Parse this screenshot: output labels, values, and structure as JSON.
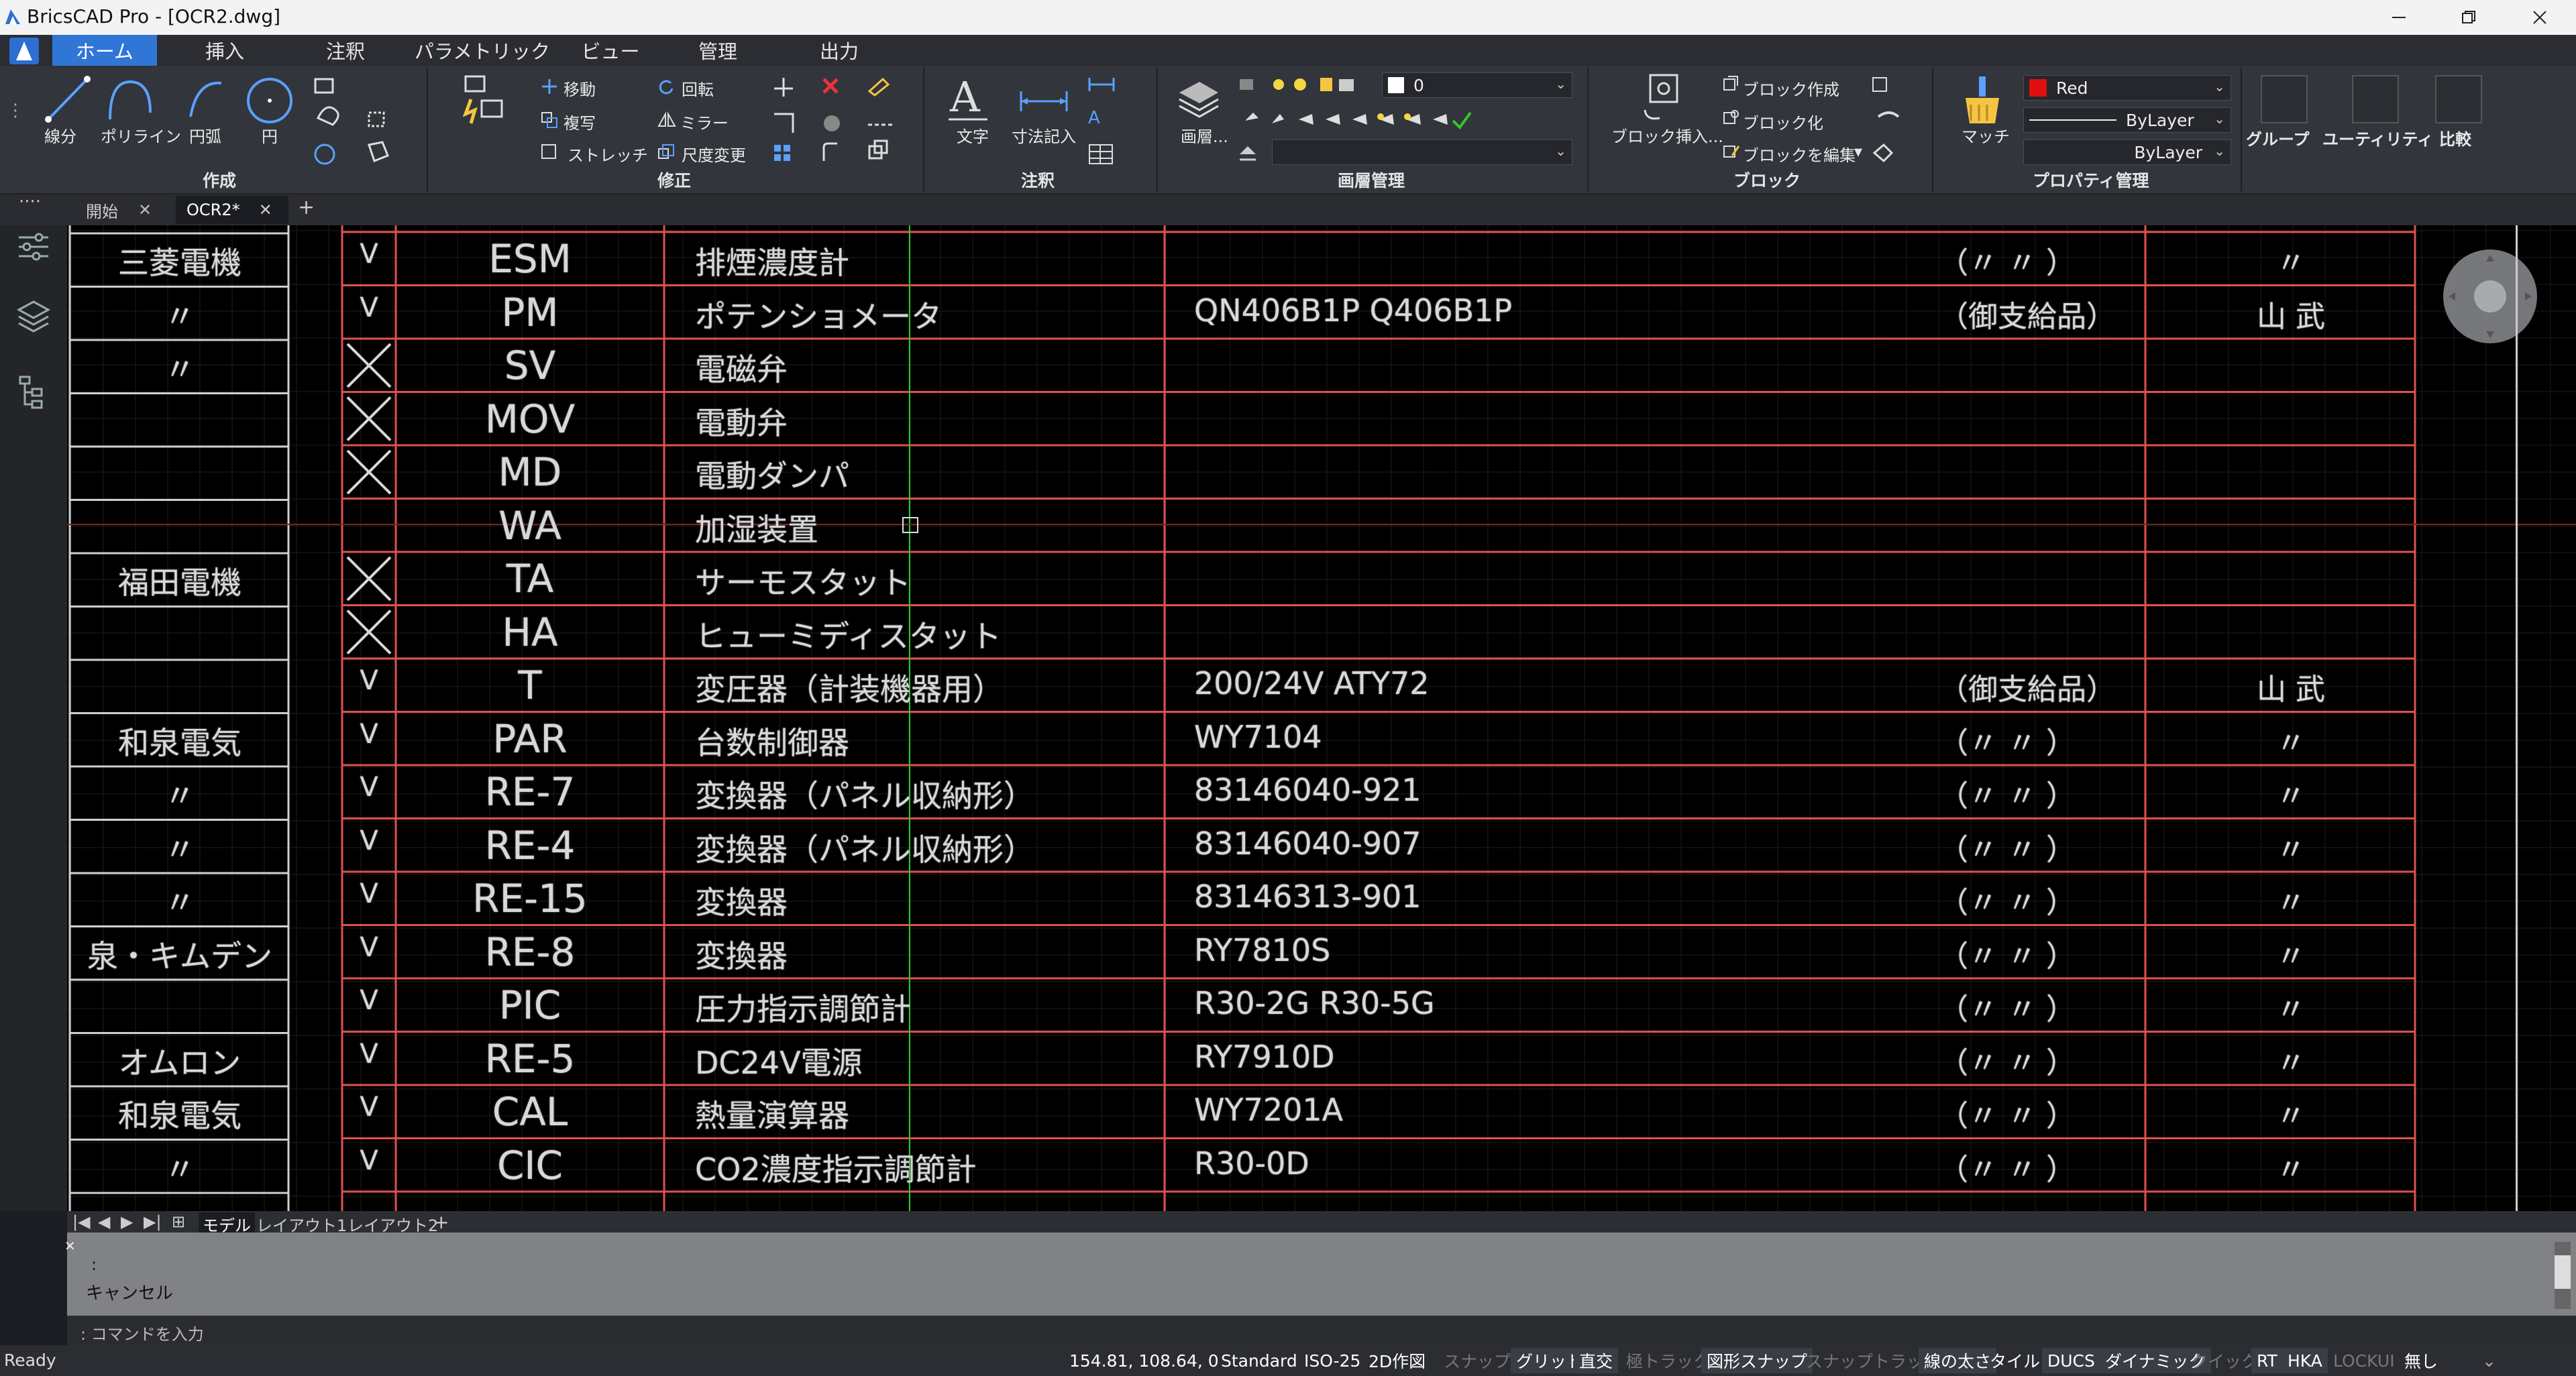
{
  "window": {
    "title": "BricsCAD Pro - [OCR2.dwg]"
  },
  "ribbon_tabs": [
    "ホーム",
    "挿入",
    "注釈",
    "パラメトリック",
    "ビュー",
    "管理",
    "出力"
  ],
  "panels": {
    "create": {
      "label": "作成",
      "tools": [
        "線分",
        "ポリライン",
        "円弧",
        "円"
      ]
    },
    "modify": {
      "label": "修正",
      "tools": [
        "移動",
        "複写",
        "ストレッチ",
        "回転",
        "ミラー",
        "尺度変更"
      ]
    },
    "annotation": {
      "label": "注釈",
      "tools": [
        "文字",
        "寸法記入"
      ]
    },
    "layers": {
      "label": "画層管理",
      "tool": "画層...",
      "current_layer": "0"
    },
    "block": {
      "label": "ブロック",
      "tools": [
        "ブロック挿入...",
        "ブロック作成",
        "ブロック化",
        "ブロックを編集"
      ]
    },
    "properties": {
      "label": "プロパティ管理",
      "match": "マッチ",
      "color": "Red",
      "linetype": "ByLayer",
      "lineweight": "ByLayer"
    },
    "extra": [
      "グループ",
      "ユーティリティ",
      "比較"
    ]
  },
  "doc_tabs": [
    "開始",
    "OCR2*"
  ],
  "layout_tabs": [
    "モデル",
    "レイアウト1",
    "レイアウト2"
  ],
  "table_rows": [
    {
      "maker": "三菱電機",
      "check": "V",
      "tag": "ESM",
      "name": "排煙濃度計",
      "model": "",
      "note": "（〃 〃 ）",
      "dept": "〃"
    },
    {
      "maker": "〃",
      "check": "V",
      "tag": "PM",
      "name": "ポテンショメータ",
      "model": "QN406B1P Q406B1P",
      "note": "（御支給品）",
      "dept": "山 武"
    },
    {
      "maker": "〃",
      "check": "X",
      "tag": "SV",
      "name": "電磁弁",
      "model": "",
      "note": "",
      "dept": ""
    },
    {
      "maker": "",
      "check": "X",
      "tag": "MOV",
      "name": "電動弁",
      "model": "",
      "note": "",
      "dept": ""
    },
    {
      "maker": "",
      "check": "X",
      "tag": "MD",
      "name": "電動ダンパ",
      "model": "",
      "note": "",
      "dept": ""
    },
    {
      "maker": "",
      "check": "",
      "tag": "WA",
      "name": "加湿装置",
      "model": "",
      "note": "",
      "dept": ""
    },
    {
      "maker": "福田電機",
      "check": "X",
      "tag": "TA",
      "name": "サーモスタット",
      "model": "",
      "note": "",
      "dept": ""
    },
    {
      "maker": "",
      "check": "X",
      "tag": "HA",
      "name": "ヒューミディスタット",
      "model": "",
      "note": "",
      "dept": ""
    },
    {
      "maker": "",
      "check": "V",
      "tag": "T",
      "name": "変圧器（計装機器用）",
      "model": "200/24V ATY72",
      "note": "（御支給品）",
      "dept": "山 武"
    },
    {
      "maker": "和泉電気",
      "check": "V",
      "tag": "PAR",
      "name": "台数制御器",
      "model": "WY7104",
      "note": "（〃 〃 ）",
      "dept": "〃"
    },
    {
      "maker": "〃",
      "check": "V",
      "tag": "RE-7",
      "name": "変換器（パネル収納形）",
      "model": "83146040-921",
      "note": "（〃 〃 ）",
      "dept": "〃"
    },
    {
      "maker": "〃",
      "check": "V",
      "tag": "RE-4",
      "name": "変換器（パネル収納形）",
      "model": "83146040-907",
      "note": "（〃 〃 ）",
      "dept": "〃"
    },
    {
      "maker": "〃",
      "check": "V",
      "tag": "RE-15",
      "name": "変換器",
      "model": "83146313-901",
      "note": "（〃 〃 ）",
      "dept": "〃"
    },
    {
      "maker": "泉・キムデン",
      "check": "V",
      "tag": "RE-8",
      "name": "変換器",
      "model": "RY7810S",
      "note": "（〃 〃 ）",
      "dept": "〃"
    },
    {
      "maker": "",
      "check": "V",
      "tag": "PIC",
      "name": "圧力指示調節計",
      "model": "R30-2G R30-5G",
      "note": "（〃 〃 ）",
      "dept": "〃"
    },
    {
      "maker": "オムロン",
      "check": "V",
      "tag": "RE-5",
      "name": "DC24V電源",
      "model": "RY7910D",
      "note": "（〃 〃 ）",
      "dept": "〃"
    },
    {
      "maker": "和泉電気",
      "check": "V",
      "tag": "CAL",
      "name": "熱量演算器",
      "model": "WY7201A",
      "note": "（〃 〃 ）",
      "dept": "〃"
    },
    {
      "maker": "〃",
      "check": "V",
      "tag": "CIC",
      "name": "CO2濃度指示調節計",
      "model": "R30-0D",
      "note": "（〃 〃 ）",
      "dept": "〃"
    }
  ],
  "command": {
    "line1": ":",
    "line2": "キャンセル",
    "prompt": ": コマンドを入力"
  },
  "status": {
    "ready": "Ready",
    "coords": "154.81, 108.64, 0",
    "items": [
      "Standard",
      "ISO-25",
      "2D作図",
      "スナップ",
      "グリッド",
      "直交",
      "極トラック",
      "図形スナップ",
      "スナップトラック",
      "線の太さ",
      "タイル",
      "DUCS",
      "ダイナミック",
      "クイック",
      "RT",
      "HKA",
      "LOCKUI",
      "無し"
    ]
  },
  "colors": {
    "accent": "#2f76d6",
    "table_line": "#e05050",
    "cad_cyan": "#1fc7c7",
    "cursor_green": "#2ec82e"
  }
}
